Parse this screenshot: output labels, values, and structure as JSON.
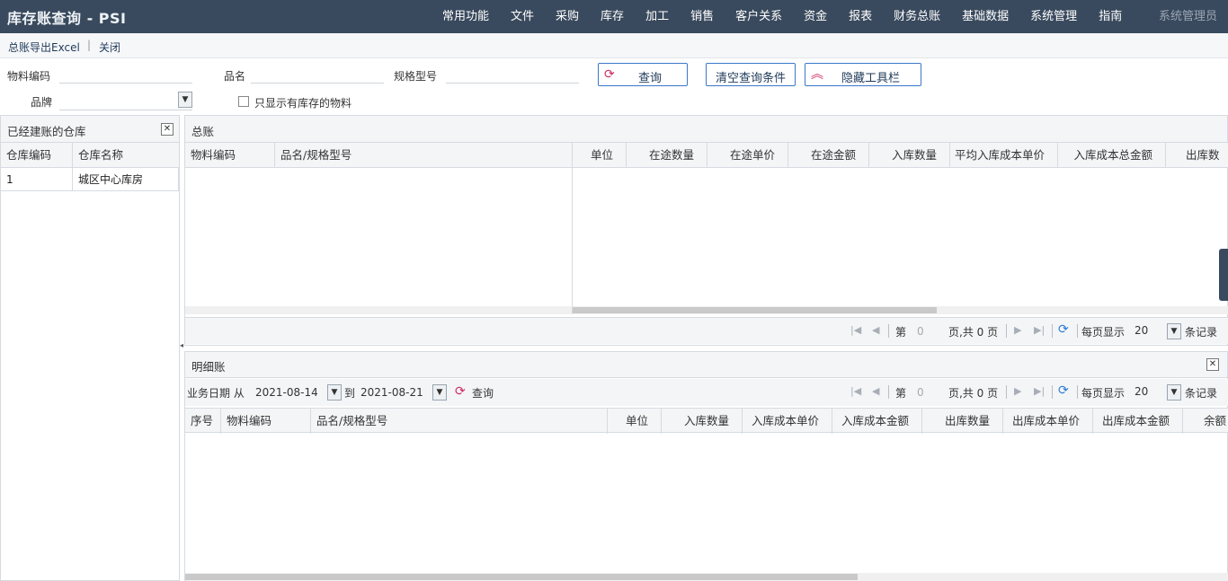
{
  "app": {
    "title": "库存账查询 - PSI",
    "user": "系统管理员"
  },
  "menu": [
    "常用功能",
    "文件",
    "采购",
    "库存",
    "加工",
    "销售",
    "客户关系",
    "资金",
    "报表",
    "财务总账",
    "基础数据",
    "系统管理",
    "指南"
  ],
  "actions": {
    "export": "总账导出Excel",
    "separator": "|",
    "close": "关闭"
  },
  "query": {
    "material_code_label": "物料编码",
    "material_code_value": "",
    "name_label": "品名",
    "name_value": "",
    "spec_label": "规格型号",
    "spec_value": "",
    "brand_label": "品牌",
    "brand_value": "",
    "only_stock_label": "只显示有库存的物料",
    "only_stock_checked": false,
    "search_btn": "查询",
    "clear_btn": "清空查询条件",
    "hide_toolbar_btn": "隐藏工具栏"
  },
  "warehouse_panel": {
    "title": "已经建账的仓库",
    "columns": [
      "仓库编码",
      "仓库名称"
    ],
    "rows": [
      {
        "code": "1",
        "name": "城区中心库房"
      }
    ]
  },
  "ledger_panel": {
    "title": "总账",
    "frozen_columns": [
      "物料编码",
      "品名/规格型号"
    ],
    "columns": [
      "单位",
      "在途数量",
      "在途单价",
      "在途金额",
      "入库数量",
      "平均入库成本单价",
      "入库成本总金额",
      "出库数"
    ]
  },
  "pager": {
    "page_prefix": "第",
    "page_value": "0",
    "page_suffix": "页,共 0 页",
    "per_page_label": "每页显示",
    "per_page_value": "20",
    "records_label": "条记录"
  },
  "detail_panel": {
    "title": "明细账",
    "date_label": "业务日期 从",
    "date_from": "2021-08-14",
    "to_label": "到",
    "date_to": "2021-08-21",
    "search_btn": "查询",
    "columns": [
      "序号",
      "物料编码",
      "品名/规格型号",
      "单位",
      "入库数量",
      "入库成本单价",
      "入库成本金额",
      "出库数量",
      "出库成本单价",
      "出库成本金额",
      "余额"
    ]
  },
  "colors": {
    "topbar": "#3a4a5e",
    "accent": "#3a78c8",
    "icon_red": "#d22a5e"
  }
}
